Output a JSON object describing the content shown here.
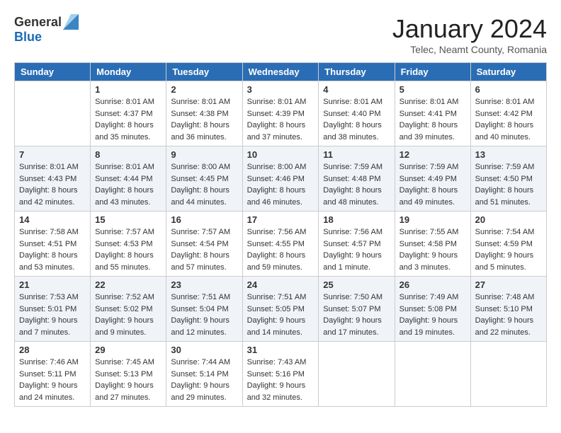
{
  "logo": {
    "general": "General",
    "blue": "Blue"
  },
  "title": "January 2024",
  "location": "Telec, Neamt County, Romania",
  "days_of_week": [
    "Sunday",
    "Monday",
    "Tuesday",
    "Wednesday",
    "Thursday",
    "Friday",
    "Saturday"
  ],
  "weeks": [
    [
      {
        "day": "",
        "info": ""
      },
      {
        "day": "1",
        "info": "Sunrise: 8:01 AM\nSunset: 4:37 PM\nDaylight: 8 hours\nand 35 minutes."
      },
      {
        "day": "2",
        "info": "Sunrise: 8:01 AM\nSunset: 4:38 PM\nDaylight: 8 hours\nand 36 minutes."
      },
      {
        "day": "3",
        "info": "Sunrise: 8:01 AM\nSunset: 4:39 PM\nDaylight: 8 hours\nand 37 minutes."
      },
      {
        "day": "4",
        "info": "Sunrise: 8:01 AM\nSunset: 4:40 PM\nDaylight: 8 hours\nand 38 minutes."
      },
      {
        "day": "5",
        "info": "Sunrise: 8:01 AM\nSunset: 4:41 PM\nDaylight: 8 hours\nand 39 minutes."
      },
      {
        "day": "6",
        "info": "Sunrise: 8:01 AM\nSunset: 4:42 PM\nDaylight: 8 hours\nand 40 minutes."
      }
    ],
    [
      {
        "day": "7",
        "info": "Sunrise: 8:01 AM\nSunset: 4:43 PM\nDaylight: 8 hours\nand 42 minutes."
      },
      {
        "day": "8",
        "info": "Sunrise: 8:01 AM\nSunset: 4:44 PM\nDaylight: 8 hours\nand 43 minutes."
      },
      {
        "day": "9",
        "info": "Sunrise: 8:00 AM\nSunset: 4:45 PM\nDaylight: 8 hours\nand 44 minutes."
      },
      {
        "day": "10",
        "info": "Sunrise: 8:00 AM\nSunset: 4:46 PM\nDaylight: 8 hours\nand 46 minutes."
      },
      {
        "day": "11",
        "info": "Sunrise: 7:59 AM\nSunset: 4:48 PM\nDaylight: 8 hours\nand 48 minutes."
      },
      {
        "day": "12",
        "info": "Sunrise: 7:59 AM\nSunset: 4:49 PM\nDaylight: 8 hours\nand 49 minutes."
      },
      {
        "day": "13",
        "info": "Sunrise: 7:59 AM\nSunset: 4:50 PM\nDaylight: 8 hours\nand 51 minutes."
      }
    ],
    [
      {
        "day": "14",
        "info": "Sunrise: 7:58 AM\nSunset: 4:51 PM\nDaylight: 8 hours\nand 53 minutes."
      },
      {
        "day": "15",
        "info": "Sunrise: 7:57 AM\nSunset: 4:53 PM\nDaylight: 8 hours\nand 55 minutes."
      },
      {
        "day": "16",
        "info": "Sunrise: 7:57 AM\nSunset: 4:54 PM\nDaylight: 8 hours\nand 57 minutes."
      },
      {
        "day": "17",
        "info": "Sunrise: 7:56 AM\nSunset: 4:55 PM\nDaylight: 8 hours\nand 59 minutes."
      },
      {
        "day": "18",
        "info": "Sunrise: 7:56 AM\nSunset: 4:57 PM\nDaylight: 9 hours\nand 1 minute."
      },
      {
        "day": "19",
        "info": "Sunrise: 7:55 AM\nSunset: 4:58 PM\nDaylight: 9 hours\nand 3 minutes."
      },
      {
        "day": "20",
        "info": "Sunrise: 7:54 AM\nSunset: 4:59 PM\nDaylight: 9 hours\nand 5 minutes."
      }
    ],
    [
      {
        "day": "21",
        "info": "Sunrise: 7:53 AM\nSunset: 5:01 PM\nDaylight: 9 hours\nand 7 minutes."
      },
      {
        "day": "22",
        "info": "Sunrise: 7:52 AM\nSunset: 5:02 PM\nDaylight: 9 hours\nand 9 minutes."
      },
      {
        "day": "23",
        "info": "Sunrise: 7:51 AM\nSunset: 5:04 PM\nDaylight: 9 hours\nand 12 minutes."
      },
      {
        "day": "24",
        "info": "Sunrise: 7:51 AM\nSunset: 5:05 PM\nDaylight: 9 hours\nand 14 minutes."
      },
      {
        "day": "25",
        "info": "Sunrise: 7:50 AM\nSunset: 5:07 PM\nDaylight: 9 hours\nand 17 minutes."
      },
      {
        "day": "26",
        "info": "Sunrise: 7:49 AM\nSunset: 5:08 PM\nDaylight: 9 hours\nand 19 minutes."
      },
      {
        "day": "27",
        "info": "Sunrise: 7:48 AM\nSunset: 5:10 PM\nDaylight: 9 hours\nand 22 minutes."
      }
    ],
    [
      {
        "day": "28",
        "info": "Sunrise: 7:46 AM\nSunset: 5:11 PM\nDaylight: 9 hours\nand 24 minutes."
      },
      {
        "day": "29",
        "info": "Sunrise: 7:45 AM\nSunset: 5:13 PM\nDaylight: 9 hours\nand 27 minutes."
      },
      {
        "day": "30",
        "info": "Sunrise: 7:44 AM\nSunset: 5:14 PM\nDaylight: 9 hours\nand 29 minutes."
      },
      {
        "day": "31",
        "info": "Sunrise: 7:43 AM\nSunset: 5:16 PM\nDaylight: 9 hours\nand 32 minutes."
      },
      {
        "day": "",
        "info": ""
      },
      {
        "day": "",
        "info": ""
      },
      {
        "day": "",
        "info": ""
      }
    ]
  ]
}
